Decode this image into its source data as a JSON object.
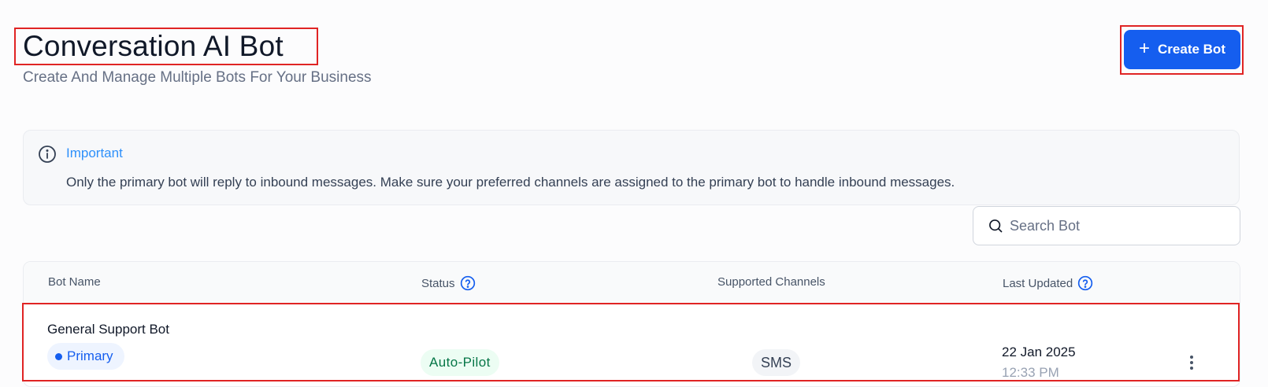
{
  "header": {
    "title": "Conversation AI Bot",
    "subtitle": "Create And Manage Multiple Bots For Your Business",
    "create_button_label": "Create Bot"
  },
  "notice": {
    "icon": "info-icon",
    "title": "Important",
    "body": "Only the primary bot will reply to inbound messages. Make sure your preferred channels are assigned to the primary bot to handle inbound messages."
  },
  "search": {
    "icon": "search-icon",
    "placeholder": "Search Bot",
    "value": ""
  },
  "table": {
    "columns": {
      "bot_name": "Bot Name",
      "status": "Status",
      "channels": "Supported Channels",
      "last_updated": "Last Updated"
    },
    "rows": [
      {
        "name": "General Support Bot",
        "badge": "Primary",
        "status": "Auto-Pilot",
        "channel": "SMS",
        "date": "22 Jan 2025",
        "time": "12:33 PM"
      }
    ]
  },
  "colors": {
    "primary": "#155eef",
    "highlight_border": "#e02424",
    "status_green": "#067647",
    "info_blue": "#2e90fa"
  }
}
